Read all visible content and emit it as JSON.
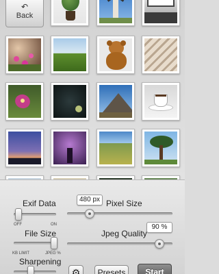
{
  "toolbar": {
    "back_label": "Back",
    "back_icon": "back-arrow-icon"
  },
  "photos": [
    "plant-pot",
    "windmill",
    "window-interior",
    "pink-flowers",
    "green-field",
    "teddy-bear",
    "rope-knots",
    "pink-flower",
    "dark-sphere",
    "mountain",
    "coffee-cup",
    "sunset-sky",
    "purple-tree",
    "vineyard",
    "pine-tree",
    "cityscape",
    "partial-photo",
    "partial-photo",
    "partial-photo"
  ],
  "settings": {
    "exif_label": "Exif Data",
    "exif_off": "OFF",
    "exif_on": "ON",
    "pixel_size_label": "Pixel Size",
    "pixel_size_value": "480 px",
    "file_size_label": "File Size",
    "file_kb_limit": "KB LIMIT",
    "file_jpeg": "JPEG %",
    "jpeg_quality_label": "Jpeg Quality",
    "jpeg_quality_value": "90 %",
    "sharpening_label": "Sharpening",
    "presets_label": "Presets",
    "start_label": "Start"
  },
  "colors": {
    "accent_dark": "#6e6e6e",
    "panel_bg": "#e3e3e3"
  }
}
